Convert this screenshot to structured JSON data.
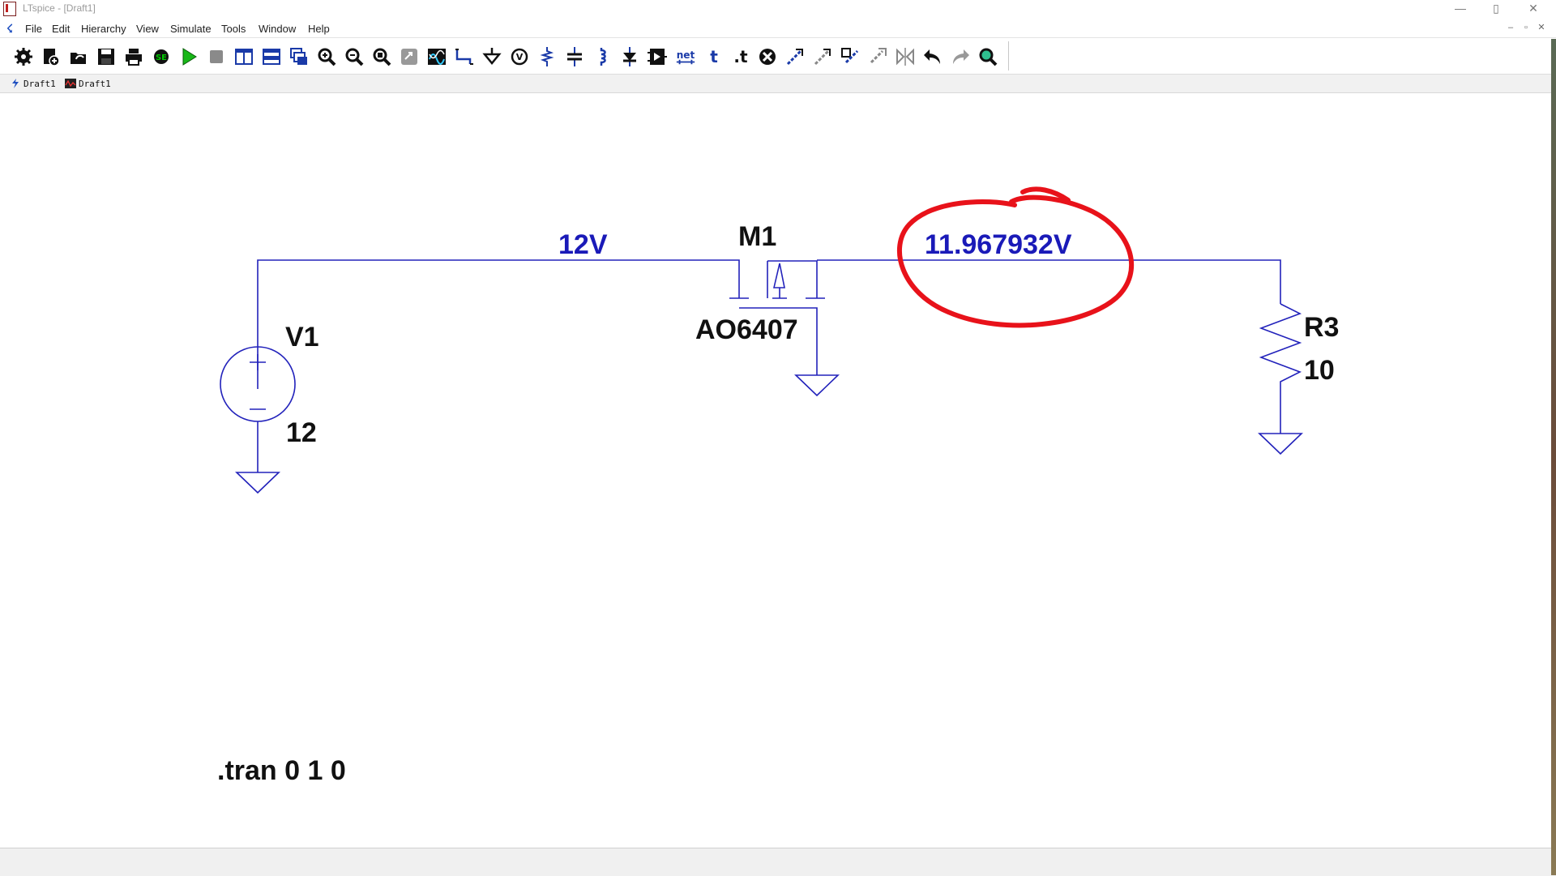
{
  "window": {
    "title": "LTspice - [Draft1]",
    "controls": [
      "—",
      "▯",
      "✕"
    ]
  },
  "menu": {
    "items": [
      "File",
      "Edit",
      "Hierarchy",
      "View",
      "Simulate",
      "Tools",
      "Window",
      "Help"
    ],
    "mdi_controls": [
      "–",
      "▫",
      "✕"
    ]
  },
  "toolbar": {
    "buttons": [
      "gear-icon",
      "new-schematic-icon",
      "open-icon",
      "save-icon",
      "print-icon",
      "control-panel-icon",
      "run-icon",
      "halt-icon",
      "tile-vertical-icon",
      "tile-horizontal-icon",
      "cascade-icon",
      "zoom-in-icon",
      "zoom-out-icon",
      "zoom-fit-icon",
      "zoom-area-icon",
      "waveform-icon",
      "wire-icon",
      "ground-icon",
      "label-net-icon",
      "resistor-icon",
      "capacitor-icon",
      "inductor-icon",
      "diode-icon",
      "component-icon",
      "net-icon",
      "text-icon",
      "spice-directive-icon",
      "delete-icon",
      "duplicate-icon",
      "move-icon",
      "drag-icon",
      "rotate-icon",
      "mirror-icon",
      "undo-icon",
      "redo-icon",
      "find-icon"
    ],
    "net_label": "net",
    "text_label": "t",
    "directive_label": ".t"
  },
  "tabs": [
    {
      "label": "Draft1",
      "icon": "schematic-icon"
    },
    {
      "label": "Draft1",
      "icon": "waveform-icon"
    }
  ],
  "schematic": {
    "wire_color": "#2222bb",
    "label_color": "#1a1ab8",
    "annotation_color": "#e8121a",
    "node_voltage_left": "12V",
    "node_voltage_right": "11.967932V",
    "mosfet": {
      "ref": "M1",
      "model": "AO6407"
    },
    "source": {
      "ref": "V1",
      "value": "12"
    },
    "resistor": {
      "ref": "R3",
      "value": "10"
    },
    "directive": ".tran 0 1 0"
  }
}
